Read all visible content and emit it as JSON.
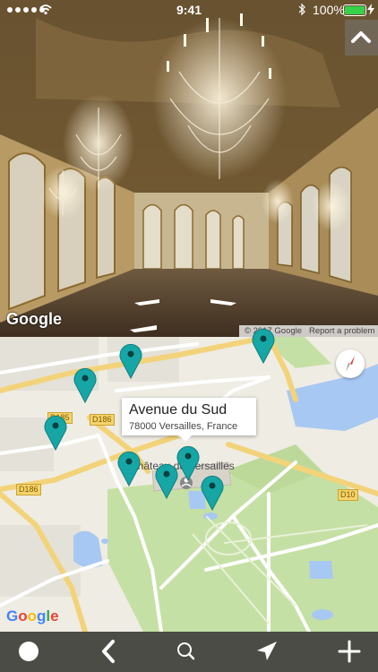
{
  "status_bar": {
    "time": "9:41",
    "battery": "100%"
  },
  "street_view": {
    "logo": "Google",
    "copyright": "© 2017 Google",
    "report": "Report a problem"
  },
  "map": {
    "callout": {
      "title": "Avenue du Sud",
      "subtitle": "78000 Versailles, France"
    },
    "poi_label": "Château de Versailles",
    "roads": [
      "D185",
      "D186",
      "D186",
      "D10"
    ],
    "logo": [
      "G",
      "o",
      "o",
      "g",
      "l",
      "e"
    ],
    "pin_color": "#17a6a6"
  },
  "toolbar": {
    "icons": [
      "circle-icon",
      "back-chevron-icon",
      "search-icon",
      "location-arrow-icon",
      "add-icon"
    ]
  }
}
